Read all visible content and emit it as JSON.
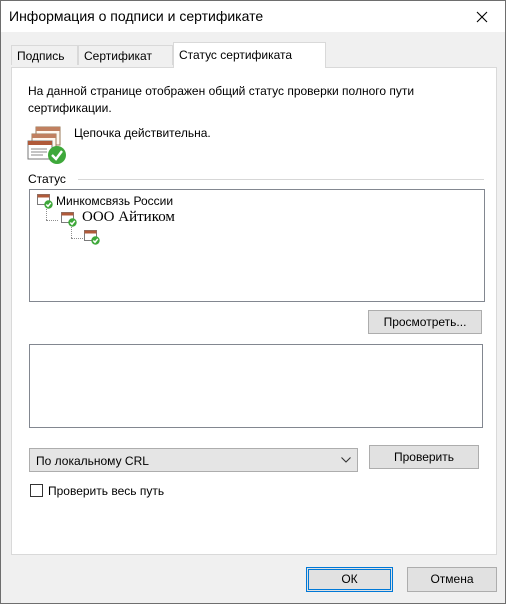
{
  "window": {
    "title": "Информация о подписи и сертификате"
  },
  "tabs": [
    {
      "label": "Подпись",
      "active": false
    },
    {
      "label": "Сертификат",
      "active": false
    },
    {
      "label": "Статус сертификата",
      "active": true
    }
  ],
  "panel": {
    "description": "На данной странице отображен общий статус проверки полного пути сертификации.",
    "chain_status": "Цепочка действительна.",
    "status_label": "Статус",
    "tree": [
      {
        "label": "Минкомсвязь России",
        "icon": "cert-valid-icon"
      },
      {
        "label": "ООО Айтиком",
        "icon": "cert-valid-icon"
      },
      {
        "label": "",
        "icon": "cert-valid-icon"
      }
    ],
    "view_button": "Просмотреть...",
    "crl_select": {
      "value": "По локальному CRL"
    },
    "verify_button": "Проверить",
    "check_full_path": {
      "label": "Проверить весь путь",
      "checked": false
    }
  },
  "footer": {
    "ok": "ОК",
    "cancel": "Отмена"
  },
  "colors": {
    "accent": "#0078d7",
    "check_green": "#3ea83a"
  }
}
